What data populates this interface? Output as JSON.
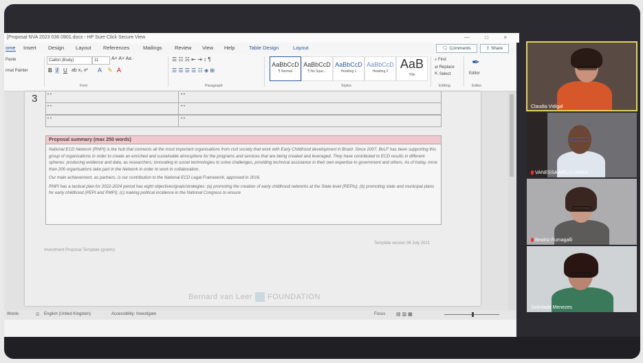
{
  "window": {
    "title": "[Proposal NVA 2023 036 0901.docx - HP Sure Click Secure View",
    "controls": "— □ ×"
  },
  "tabs": [
    {
      "label": "ome",
      "active": true
    },
    {
      "label": "Insert"
    },
    {
      "label": "Design"
    },
    {
      "label": "Layout"
    },
    {
      "label": "References"
    },
    {
      "label": "Mailings"
    },
    {
      "label": "Review"
    },
    {
      "label": "View"
    },
    {
      "label": "Help"
    },
    {
      "label": "Table Design"
    },
    {
      "label": "Layout"
    }
  ],
  "ribbon": {
    "comments_label": "Comments",
    "share_label": "Share",
    "format_painter": "rmat Painter",
    "font_name": "Calibri (Body)",
    "font_size": "11",
    "group_font": "Font",
    "group_paragraph": "Paragraph",
    "group_styles": "Styles",
    "group_editing": "Editing",
    "group_editor": "Editor",
    "find": "Find",
    "replace": "Replace",
    "select": "Select",
    "editor": "Editor",
    "styles": [
      {
        "preview": "AaBbCcD",
        "name": "¶ Normal",
        "selected": true
      },
      {
        "preview": "AaBbCcD",
        "name": "¶ No Spac..."
      },
      {
        "preview": "AaBbCcD",
        "name": "Heading 1"
      },
      {
        "preview": "AaBbCcD",
        "name": "Heading 2"
      },
      {
        "preview": "AaB",
        "name": "Title"
      }
    ]
  },
  "document": {
    "row_number": "3",
    "table_rows": [
      {
        "c1": "• •",
        "c2": "• •"
      },
      {
        "c1": "• •",
        "c2": "• •"
      },
      {
        "c1": "• •",
        "c2": "• •"
      }
    ],
    "summary_heading": "Proposal summary (max 250 words)",
    "paragraphs": [
      "National ECD Network (RNPI) is the hub that connects all the most important organisations from civil society that work with Early Childhood development in Brazil. Since 2007, BvLF has been supporting this group of organisations in order to create an enriched and sustainable atmosphere for the programs and services that are being created and leveraged. They have contributed to ECD results in different spheres: producing evidence and data, as researchers; innovating in social technologies to solve challenges, providing technical assistance in their own expertise to government and others. As of today, more than 200 organisations take part in the Network in order to work in collaboration.",
      "Our main achievement, as partners, is our contribution to the National ECD Legal Framework, approved in 2016.",
      "RNPI has a tactical plan for 2022-2024 period has eight objectives/goals/strategies: (a) promoting the creation of early childhood networks at the State level (REPIs); (b) promoting state and municipal plans for early childhood (PEPI and PMPI); (c) making political incidence in the National Congress to ensure"
    ],
    "footer_left": "Investment Proposal Template (grants)",
    "footer_right": "Template version 06 July 2021",
    "brand_left": "Bernard van Leer",
    "brand_right": "FOUNDATION"
  },
  "statusbar": {
    "words": "Words",
    "language": "English (United Kingdom)",
    "accessibility": "Accessibility: Investigate",
    "focus": "Focus"
  },
  "participants": [
    {
      "name": "Claudia Vidigal",
      "muted": false,
      "active": true
    },
    {
      "name": "VANESSA MELO-OMEA",
      "muted": true
    },
    {
      "name": "Beatriz Fumagalli",
      "muted": true
    },
    {
      "name": "Soledade Menezes",
      "muted": false
    }
  ],
  "colors": {
    "accent": "#2b579a",
    "summary_header": "#f2c8cc",
    "active_speaker": "#e3d65a"
  }
}
